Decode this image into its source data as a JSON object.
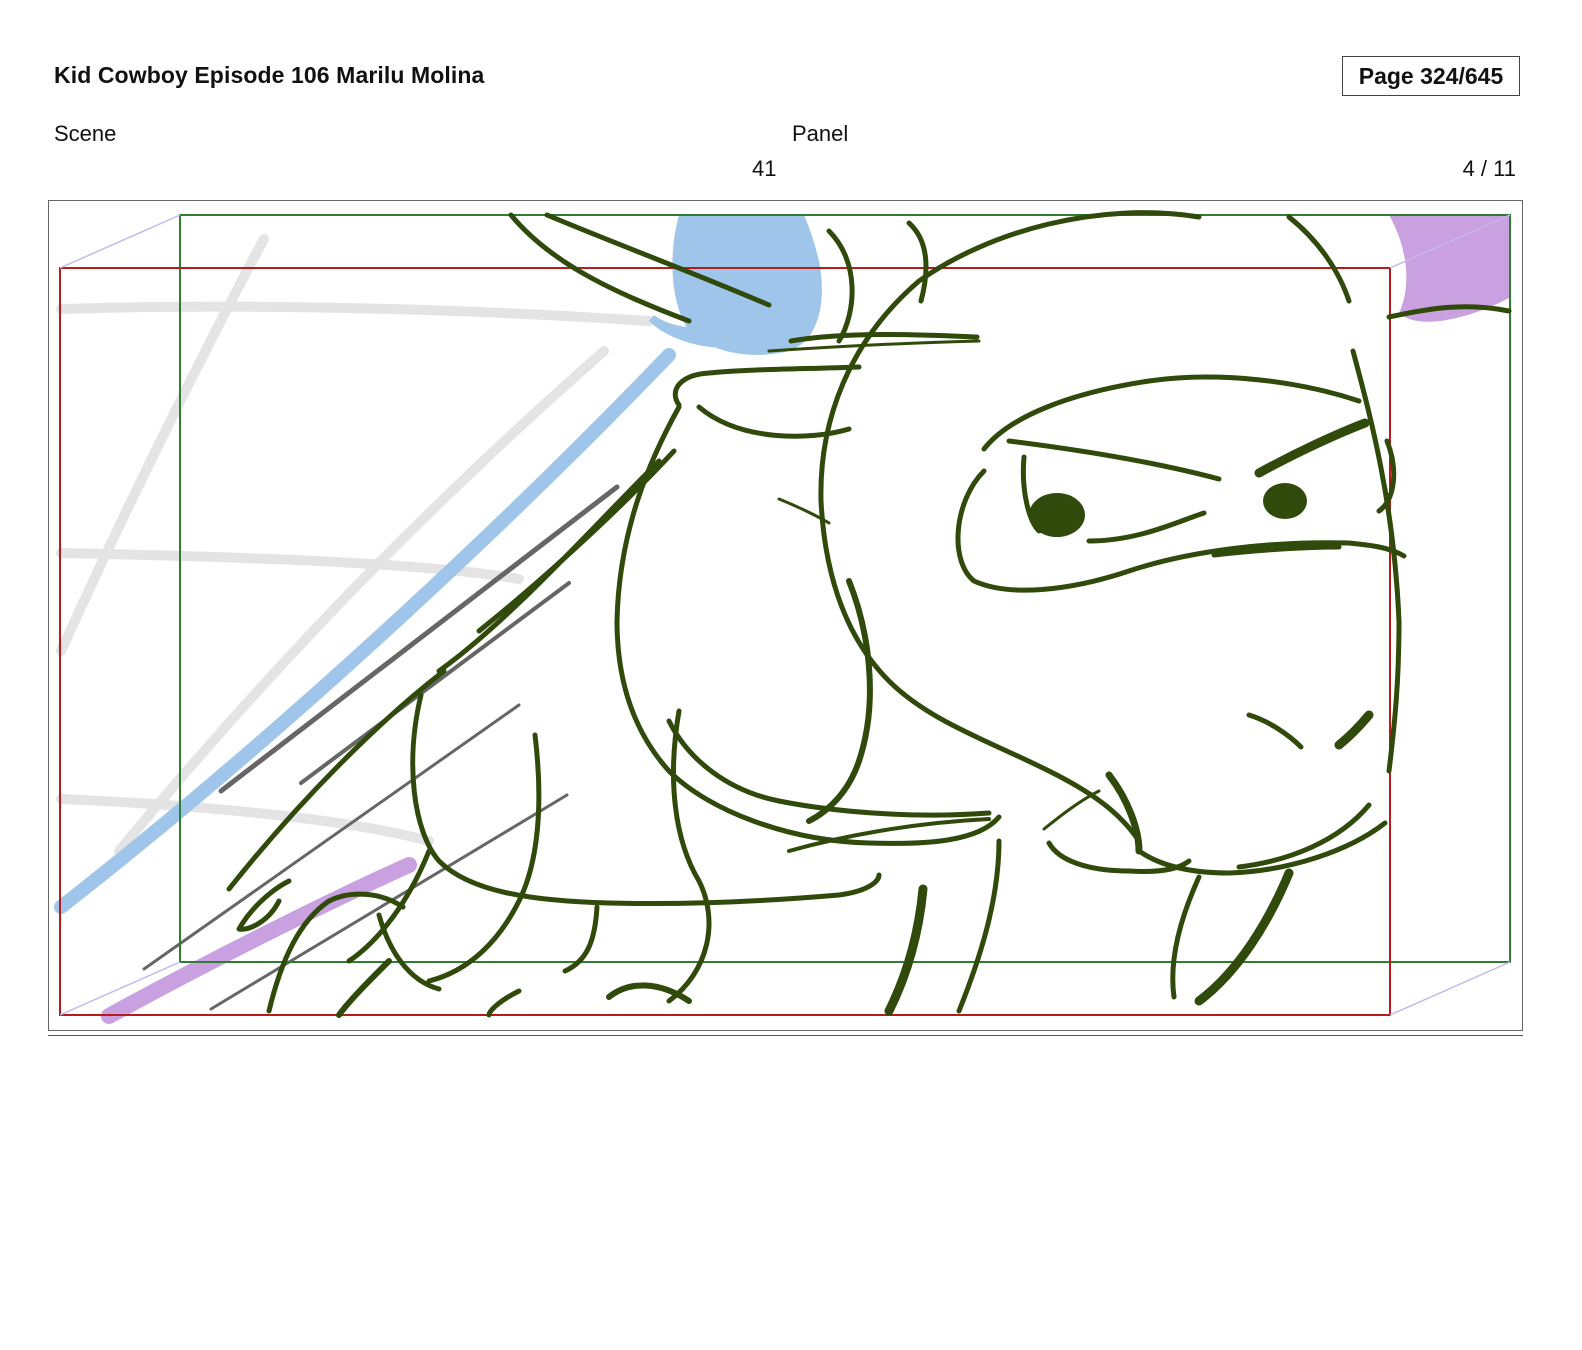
{
  "header": {
    "title": "Kid Cowboy Episode 106 Marilu Molina",
    "page": "Page 324/645"
  },
  "fields": {
    "scene_label": "Scene",
    "panel_label": "Panel",
    "scene_value": "41",
    "panel_value": "4 / 11"
  },
  "colors": {
    "safe_frame": "#2e7d32",
    "camera_frame": "#b71c1c",
    "ink": "#2f4a0a",
    "blue_accent": "#9fc6ea",
    "purple_accent": "#c9a0e0",
    "guide_gray": "#e6e6e6"
  }
}
